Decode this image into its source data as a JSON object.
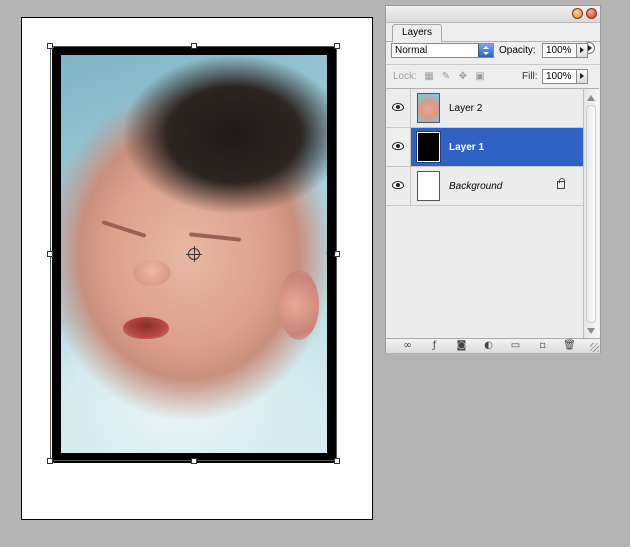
{
  "panel": {
    "tab_label": "Layers",
    "blend_mode": "Normal",
    "opacity_label": "Opacity:",
    "opacity_value": "100%",
    "lock_label": "Lock:",
    "fill_label": "Fill:",
    "fill_value": "100%"
  },
  "layers": [
    {
      "name": "Layer 2",
      "visible": true,
      "selected": false,
      "thumbnail": "baby-photo"
    },
    {
      "name": "Layer 1",
      "visible": true,
      "selected": true,
      "thumbnail": "black"
    },
    {
      "name": "Background",
      "visible": true,
      "selected": false,
      "thumbnail": "white",
      "locked": true
    }
  ],
  "icons": {
    "lock_transparency": "checker-icon",
    "lock_image": "brush-icon",
    "lock_position": "move-icon",
    "lock_all": "padlock-icon",
    "bottom_bar": [
      "link-icon",
      "fx-icon",
      "mask-icon",
      "adjustment-icon",
      "folder-icon",
      "new-layer-icon",
      "trash-icon"
    ]
  },
  "colors": {
    "selection": "#2f62c4",
    "workspace": "#b4b4b4",
    "panel": "#eeeeee"
  }
}
